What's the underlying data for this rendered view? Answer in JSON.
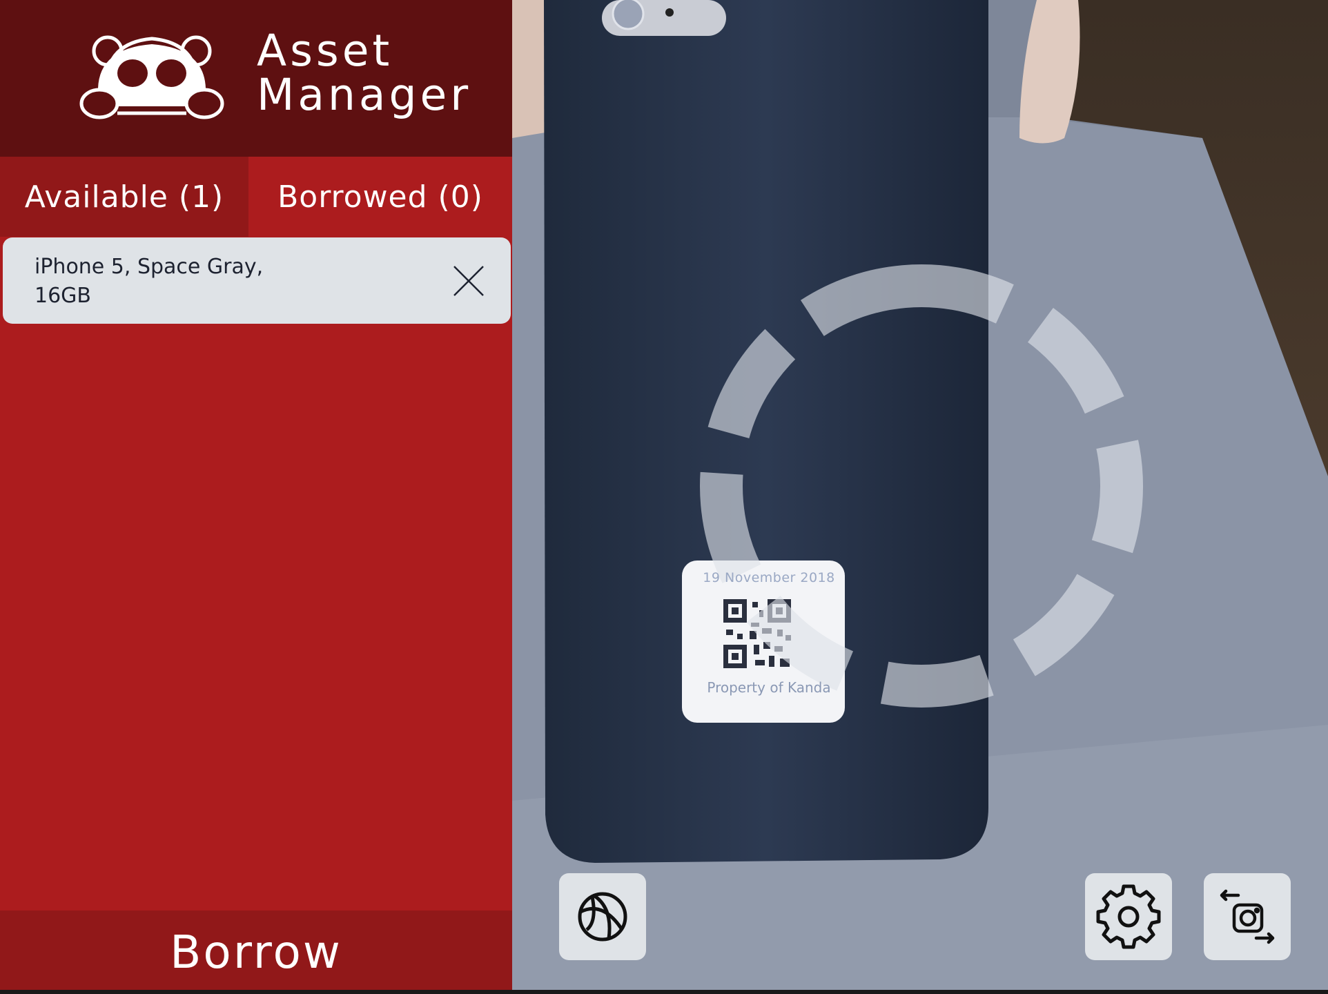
{
  "app": {
    "title_line1": "Asset",
    "title_line2": "Manager",
    "logo_icon": "panda-logo-icon"
  },
  "tabs": [
    {
      "label": "Available (1)",
      "selected": true
    },
    {
      "label": "Borrowed (0)",
      "selected": false
    }
  ],
  "assets": [
    {
      "name": "iPhone 5, Space Gray, 16GB",
      "remove_icon": "close-icon"
    }
  ],
  "actions": {
    "borrow_label": "Borrow"
  },
  "camera": {
    "label_date": "19 November 2018",
    "label_owner": "Property of Kanda",
    "scanner_icon": "scanner-ring-icon"
  },
  "toolbar": {
    "ar_icon": "globe-ball-icon",
    "settings_icon": "gear-icon",
    "switch_camera_icon": "switch-camera-icon"
  },
  "colors": {
    "header": "#5e1011",
    "panel": "#ac1c1e",
    "tab_selected": "#911819",
    "item_bg": "#dfe3e7",
    "button_bg": "#dfe3e7"
  }
}
